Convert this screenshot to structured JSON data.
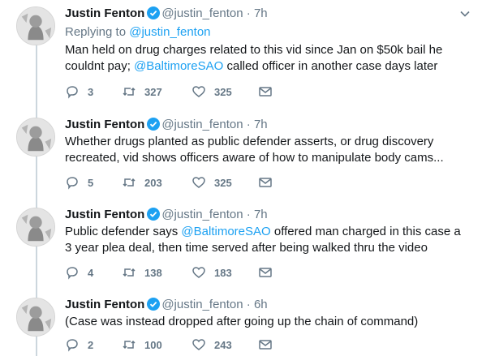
{
  "tweets": [
    {
      "name": "Justin Fenton",
      "handle": "@justin_fenton",
      "time": "7h",
      "reply_label": "Replying to",
      "reply_handle": "@justin_fenton",
      "text_a": "Man held on drug charges related to this vid since Jan on $50k bail he couldnt pay; ",
      "mention": "@BaltimoreSAO",
      "text_b": " called officer in another case days later",
      "replies": "3",
      "retweets": "327",
      "likes": "325"
    },
    {
      "name": "Justin Fenton",
      "handle": "@justin_fenton",
      "time": "7h",
      "text": "Whether drugs planted as public defender asserts, or drug discovery recreated, vid shows officers aware of how to manipulate body cams...",
      "replies": "5",
      "retweets": "203",
      "likes": "325"
    },
    {
      "name": "Justin Fenton",
      "handle": "@justin_fenton",
      "time": "7h",
      "text_a": "Public defender says ",
      "mention": "@BaltimoreSAO",
      "text_b": " offered man charged in this case a 3 year plea deal, then time served after being walked thru the video",
      "replies": "4",
      "retweets": "138",
      "likes": "183"
    },
    {
      "name": "Justin Fenton",
      "handle": "@justin_fenton",
      "time": "6h",
      "text": "(Case was instead dropped after going up the chain of command)",
      "replies": "2",
      "retweets": "100",
      "likes": "243"
    }
  ],
  "separator": "·",
  "colors": {
    "link": "#1da1f2",
    "meta": "#657786",
    "thread": "#ccd6dd"
  }
}
